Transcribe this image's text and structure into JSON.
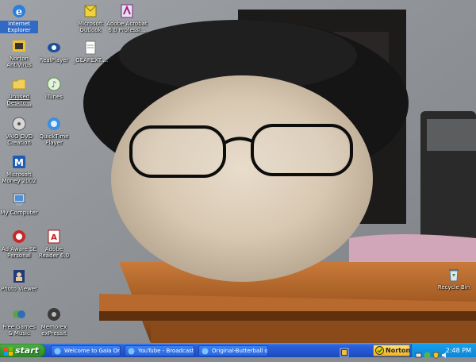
{
  "desktop": {
    "icons": [
      {
        "label": "Internet Explorer",
        "icon": "internet-explorer-icon",
        "selected": true
      },
      {
        "label": "Norton AntiVirus",
        "icon": "norton-antivirus-icon"
      },
      {
        "label": "Unused Deskto...",
        "icon": "folder-icon"
      },
      {
        "label": "VAIO DVD Creation",
        "icon": "vaio-dvd-icon"
      },
      {
        "label": "Microsoft Money 2002",
        "icon": "microsoft-money-icon"
      },
      {
        "label": "My Computer",
        "icon": "my-computer-icon"
      },
      {
        "label": "Ad-Aware SE Personal",
        "icon": "ad-aware-icon"
      },
      {
        "label": "Photo Viewer",
        "icon": "photo-viewer-icon"
      },
      {
        "label": "Free Games & Music",
        "icon": "free-games-icon"
      },
      {
        "label": "Microsoft Outlook",
        "icon": "outlook-icon"
      },
      {
        "label": "RealPlayer",
        "icon": "realplayer-icon"
      },
      {
        "label": "iTunes",
        "icon": "itunes-icon"
      },
      {
        "label": "QuickTime Player",
        "icon": "quicktime-icon"
      },
      {
        "label": "Adobe Reader 6.0",
        "icon": "adobe-reader-icon"
      },
      {
        "label": "Memorex exPressit",
        "icon": "memorex-icon"
      },
      {
        "label": "Adobe Acrobat 6.0 Professi...",
        "icon": "adobe-acrobat-icon"
      },
      {
        "label": "_GEAREXT....",
        "icon": "document-icon"
      },
      {
        "label": "Recycle Bin",
        "icon": "recycle-bin-icon"
      }
    ]
  },
  "taskbar": {
    "start_label": "start",
    "tasks": [
      {
        "label": "Welcome to Gaia Onli...",
        "icon": "ie-page-icon"
      },
      {
        "label": "YouTube - Broadcast ...",
        "icon": "ie-page-icon"
      },
      {
        "label": "Original-Butterball on ...",
        "icon": "ie-page-icon"
      }
    ],
    "norton_label": "Norton",
    "clock": "2:48 PM",
    "tray_icons": [
      "network-icon",
      "messenger-icon",
      "security-shield-icon",
      "volume-icon"
    ]
  },
  "colors": {
    "taskbar_blue": "#2455d0",
    "start_green": "#3a9d35",
    "tray_blue": "#0f86d8",
    "selection_blue": "#316ac5"
  }
}
